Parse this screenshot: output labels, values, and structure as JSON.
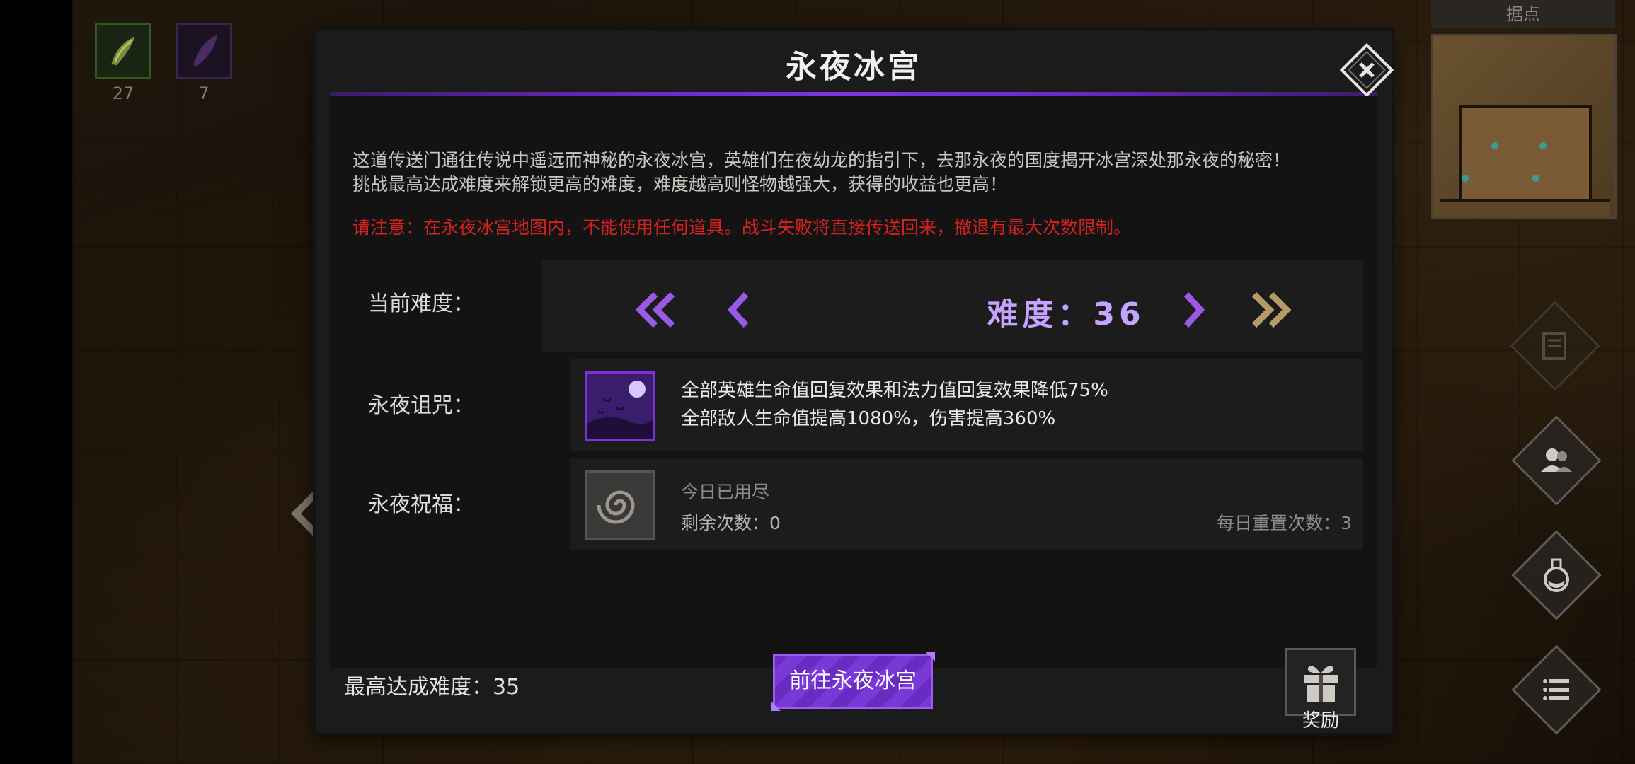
{
  "hud": {
    "inventory": [
      {
        "icon": "horn-item-icon",
        "count": "27"
      },
      {
        "icon": "feather-item-icon",
        "count": "7"
      }
    ],
    "minimap_title": "据点",
    "side_buttons": [
      "scroll-icon",
      "heroes-icon",
      "potion-icon",
      "menu-list-icon"
    ]
  },
  "dialog": {
    "title": "永夜冰宫",
    "description": "这道传送门通往传说中遥远而神秘的永夜冰宫，英雄们在夜幼龙的指引下，去那永夜的国度揭开冰宫深处那永夜的秘密！\n挑战最高达成难度来解锁更高的难度，难度越高则怪物越强大，获得的收益也更高！",
    "warning": "请注意：在永夜冰宫地图内，不能使用任何道具。战斗失败将直接传送回来，撤退有最大次数限制。",
    "difficulty": {
      "label": "当前难度：",
      "value": "难度：36"
    },
    "curse": {
      "label": "永夜诅咒：",
      "line1": "全部英雄生命值回复效果和法力值回复效果降低75%",
      "line2": "全部敌人生命值提高1080%，伤害提高360%"
    },
    "blessing": {
      "label": "永夜祝福：",
      "status": "今日已用尽",
      "remaining": "剩余次数：0",
      "daily_reset": "每日重置次数：3"
    },
    "best": "最高达成难度：35",
    "go_button": "前往永夜冰宫",
    "reward_label": "奖励"
  },
  "colors": {
    "accent_purple": "#7f35e0",
    "difficulty_text": "#c6a3ff",
    "warning_red": "#d5221f",
    "gold_arrow": "#b79a6a"
  }
}
